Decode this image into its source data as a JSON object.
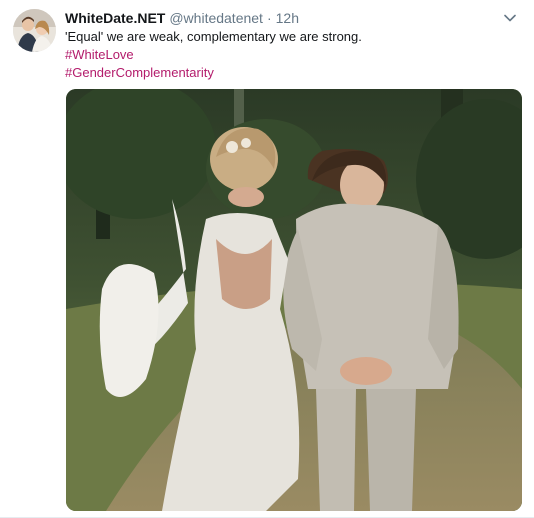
{
  "tweet": {
    "display_name": "WhiteDate.NET",
    "handle": "@whitedatenet",
    "separator": "·",
    "time": "12h",
    "text": "'Equal' we are weak, complementary we are strong.",
    "hashtags": [
      "#WhiteLove",
      "#GenderComplementarity"
    ],
    "avatar_icon": "profile-photo",
    "caret_icon": "chevron-down-icon",
    "hashtag_color": "#b31b6b"
  },
  "media": {
    "image_subject": "wedding-couple-photo"
  }
}
